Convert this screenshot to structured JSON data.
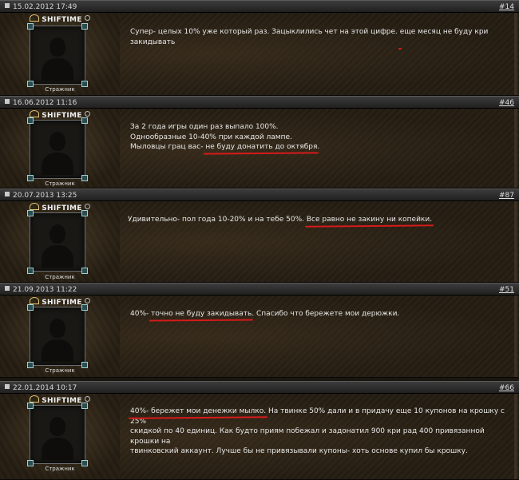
{
  "posts": [
    {
      "date": "15.02.2012 17:49",
      "number": "#14",
      "username": "SHIFTIME",
      "rank": "Стражник",
      "text_before": "Супер- целых 10% уже который раз. Зацыклились чет на этой цифре. ",
      "text_highlight": "еще месяц не буду кри закидывать",
      "text_after": ""
    },
    {
      "date": "16.06.2012 11:16",
      "number": "#46",
      "username": "SHIFTIME",
      "rank": "Стражник",
      "text_before": "За 2 года игры один раз выпало 100%.\nОднообразные 10-40% при каждой лампе.\nМыловцы грац вас- ",
      "text_highlight": "не буду донатить до октября",
      "text_after": "."
    },
    {
      "date": "20.07.2013 13:25",
      "number": "#87",
      "username": "SHIFTIME",
      "rank": "Стражник",
      "text_before": "Удивительно- пол года 10-20% и на тебе 50%. ",
      "text_highlight": "Все равно не закину ни копейки.",
      "text_after": ""
    },
    {
      "date": "21.09.2013 11:22",
      "number": "#51",
      "username": "SHIFTIME",
      "rank": "Стражник",
      "text_before": "40%- ",
      "text_highlight": "точно не буду закидывать",
      "text_after": ". Спасибо что бережете мои дерюжки."
    },
    {
      "date": "22.01.2014 10:17",
      "number": "#66",
      "username": "SHIFTIME",
      "rank": "Стражник",
      "text_before": "",
      "text_highlight": "40%- бережет мои денежки мылко.",
      "text_after": " На твинке 50% дали и в придачу еще 10 купонов на крошку с 25%\nскидкой по 40 единиц. Как будто приям побежал и задонатил 900 кри рад 400 привязанной крошки на\nтвинковский аккаунт. Лучше бы не привязывали купоны- хоть основе купил бы крошку."
    }
  ]
}
